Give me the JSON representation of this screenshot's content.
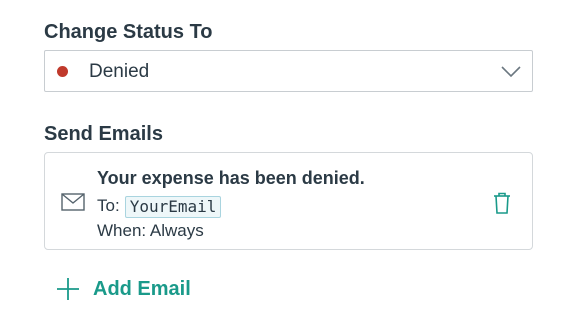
{
  "status_section": {
    "label": "Change Status To",
    "selected_value": "Denied",
    "status_color": "#c0392b",
    "dropdown_icon": "chevron-down-icon"
  },
  "emails_section": {
    "label": "Send Emails",
    "emails": [
      {
        "icon": "mail-icon",
        "subject": "Your expense has been denied.",
        "to_label": "To:",
        "to_value": "YourEmail",
        "when_text": "When: Always",
        "delete_icon": "trash-icon"
      }
    ],
    "add_button": {
      "label": "Add Email",
      "icon": "plus-icon"
    }
  },
  "colors": {
    "accent": "#1a9a8a",
    "text": "#2b3a45",
    "border": "#c8cdd1"
  }
}
